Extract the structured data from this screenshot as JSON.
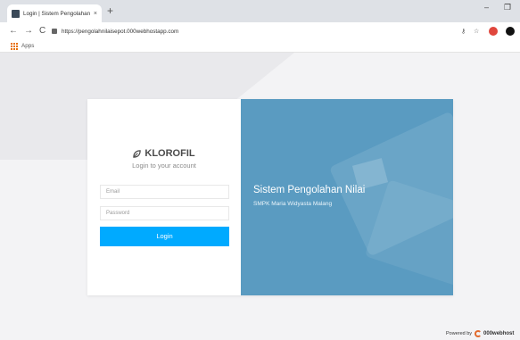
{
  "browser": {
    "tab_title": "Login | Sistem Pengolahan Nilai",
    "tab_close": "×",
    "new_tab": "+",
    "win_min": "–",
    "win_max": "❐",
    "back": "←",
    "forward": "→",
    "reload": "C",
    "url": "https://pengolahnilaisepot.000webhostapp.com",
    "bookmark_apps": "Apps",
    "key_icon": "⚷",
    "star_icon": "☆"
  },
  "login": {
    "brand": "KLOROFIL",
    "subtitle": "Login to your account",
    "email_placeholder": "Email",
    "password_placeholder": "Password",
    "button_label": "Login"
  },
  "banner": {
    "title": "Sistem Pengolahan Nilai",
    "subtitle": "SMPK Maria Widyasta Malang"
  },
  "footer": {
    "powered_prefix": "Powered by",
    "powered_brand": "000webhost"
  },
  "colors": {
    "primary_button": "#00aaff",
    "banner_blue": "#5a9bc1",
    "tab_bar": "#dee1e6"
  },
  "icons": [
    "favicon-icon",
    "lock-icon",
    "apps-icon",
    "leaf-icon",
    "key-icon",
    "star-icon",
    "extension-icon",
    "profile-icon"
  ]
}
